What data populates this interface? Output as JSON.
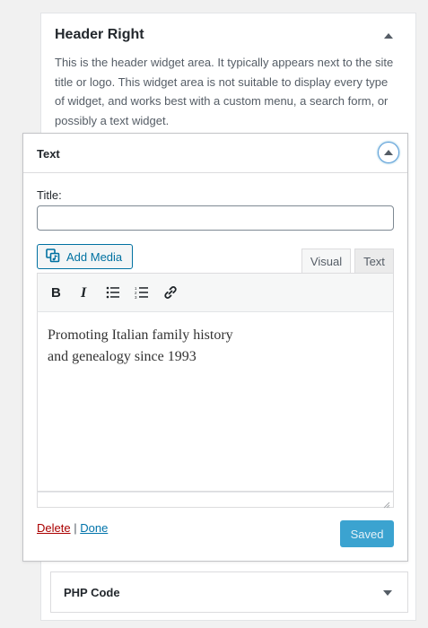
{
  "sidebar": {
    "area_title": "Header Right",
    "area_description": "This is the header widget area. It typically appears next to the site title or logo. This widget area is not suitable to display every type of widget, and works best with a custom menu, a search form, or possibly a text widget.",
    "area_toggle_icon": "triangle-up-icon"
  },
  "widget": {
    "title": "Text",
    "toggle_icon": "triangle-up-icon",
    "title_field_label": "Title:",
    "title_field_value": "",
    "add_media_label": "Add Media",
    "tabs": [
      "Visual",
      "Text"
    ],
    "active_tab": "Visual",
    "toolbar": [
      "bold-icon",
      "italic-icon",
      "bulleted-list-icon",
      "numbered-list-icon",
      "link-icon"
    ],
    "content_line1": "Promoting Italian family history",
    "content_line2": "and genealogy since 1993",
    "delete_label": "Delete",
    "separator": "|",
    "done_label": "Done",
    "save_label": "Saved"
  },
  "collapsed_widget": {
    "title": "PHP Code",
    "toggle_icon": "triangle-down-icon"
  },
  "colors": {
    "accent": "#0071a1",
    "delete": "#aa0000",
    "save_disabled": "#3ba3d0"
  }
}
